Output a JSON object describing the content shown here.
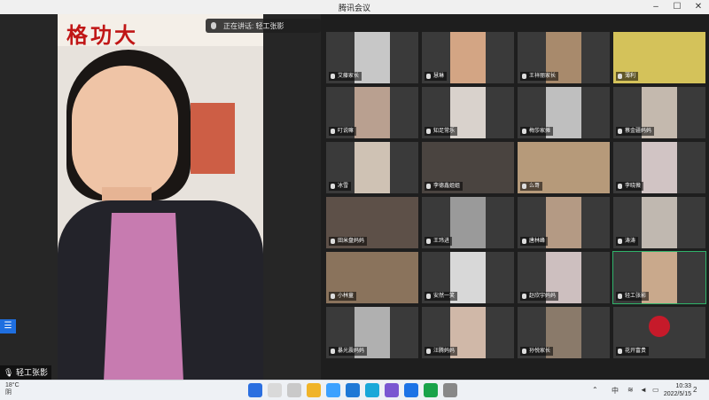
{
  "window": {
    "title": "腾讯会议",
    "controls": [
      "–",
      "☐",
      "✕"
    ]
  },
  "speaker": {
    "banner_text": "格功大",
    "name": "轻工张影",
    "speaking_prefix": "正在讲话: 轻工张影"
  },
  "participants": [
    {
      "name": "艾藤家长"
    },
    {
      "name": "慧琳"
    },
    {
      "name": "王祥丽家长"
    },
    {
      "name": "薄利"
    },
    {
      "name": "叮说嘛"
    },
    {
      "name": "知足常乐"
    },
    {
      "name": "梅莎家摊"
    },
    {
      "name": "蔡金疆妈妈"
    },
    {
      "name": "冰雪"
    },
    {
      "name": "李德鑫姐姐"
    },
    {
      "name": "么哥"
    },
    {
      "name": "李晓薇"
    },
    {
      "name": "田米盘妈妈"
    },
    {
      "name": "王玮进"
    },
    {
      "name": "唐林峰"
    },
    {
      "name": "涛涛"
    },
    {
      "name": "小林童"
    },
    {
      "name": "安然一笑"
    },
    {
      "name": "赵欣宇妈妈"
    },
    {
      "name": "轻工张影"
    },
    {
      "name": "暴光震妈妈"
    },
    {
      "name": "汪腾妈妈"
    },
    {
      "name": "孙悦家长"
    },
    {
      "name": "花开富贵"
    }
  ],
  "taskbar": {
    "weather_temp": "18°C",
    "weather_desc": "阴",
    "ime": "中",
    "time": "10:33",
    "date": "2022/5/15",
    "notifications": "2"
  }
}
